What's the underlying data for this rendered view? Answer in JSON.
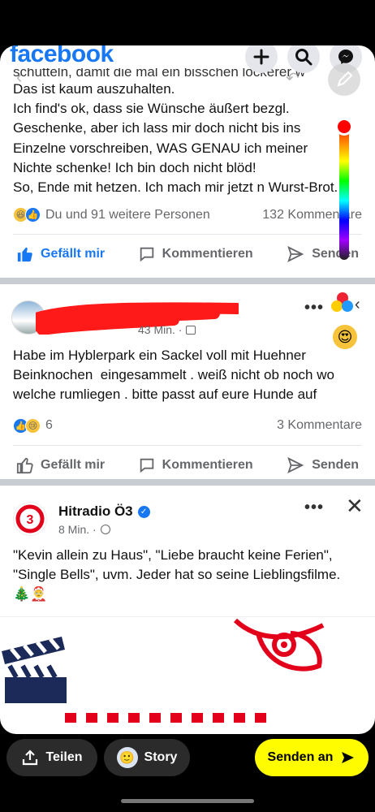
{
  "header": {
    "logo": "facebook",
    "icons": [
      "plus-icon",
      "search-icon",
      "messenger-icon"
    ]
  },
  "post1": {
    "cut_line": "schütteln, damit die mal ein bisschen lockerer w",
    "lines": [
      "Das ist kaum auszuhalten.",
      "Ich find's ok, dass sie Wünsche äußert bezgl.",
      "Geschenke, aber ich lass mir doch nicht bis ins",
      "Einzelne vorschreiben, WAS GENAU ich meiner",
      "Nichte schenke! Ich bin doch nicht blöd!",
      "So, Ende mit hetzen. Ich mach mir jetzt n Wurst-Brot."
    ],
    "reactions_text": "Du und 91 weitere Personen",
    "comments": "132 Kommentare",
    "like": "Gefällt mir",
    "comment": "Kommentieren",
    "send": "Senden"
  },
  "post2": {
    "time": "43 Min. ·",
    "text_lines": [
      "Habe im Hyblerpark ein Sackel voll mit Huehner",
      "Beinknochen  eingesammelt . weiß nicht ob noch wo",
      "welche rumliegen . bitte passt auf eure Hunde auf"
    ],
    "reaction_count": "6",
    "comments": "3 Kommentare",
    "like": "Gefällt mir",
    "comment": "Kommentieren",
    "send": "Senden"
  },
  "post3": {
    "author": "Hitradio Ö3",
    "time": "8 Min. ·",
    "text_lines": [
      "\"Kevin allein zu Haus\", \"Liebe braucht keine Ferien\",",
      "\"Single Bells\", uvm. Jeder hat so seine Lieblingsfilme.",
      "🎄🤶"
    ]
  },
  "bottom": {
    "share": "Teilen",
    "story": "Story",
    "send_to": "Senden an"
  },
  "colors": {
    "brand": "#1877f2",
    "snap_yellow": "#fffc00",
    "o3_red": "#e2001a"
  }
}
